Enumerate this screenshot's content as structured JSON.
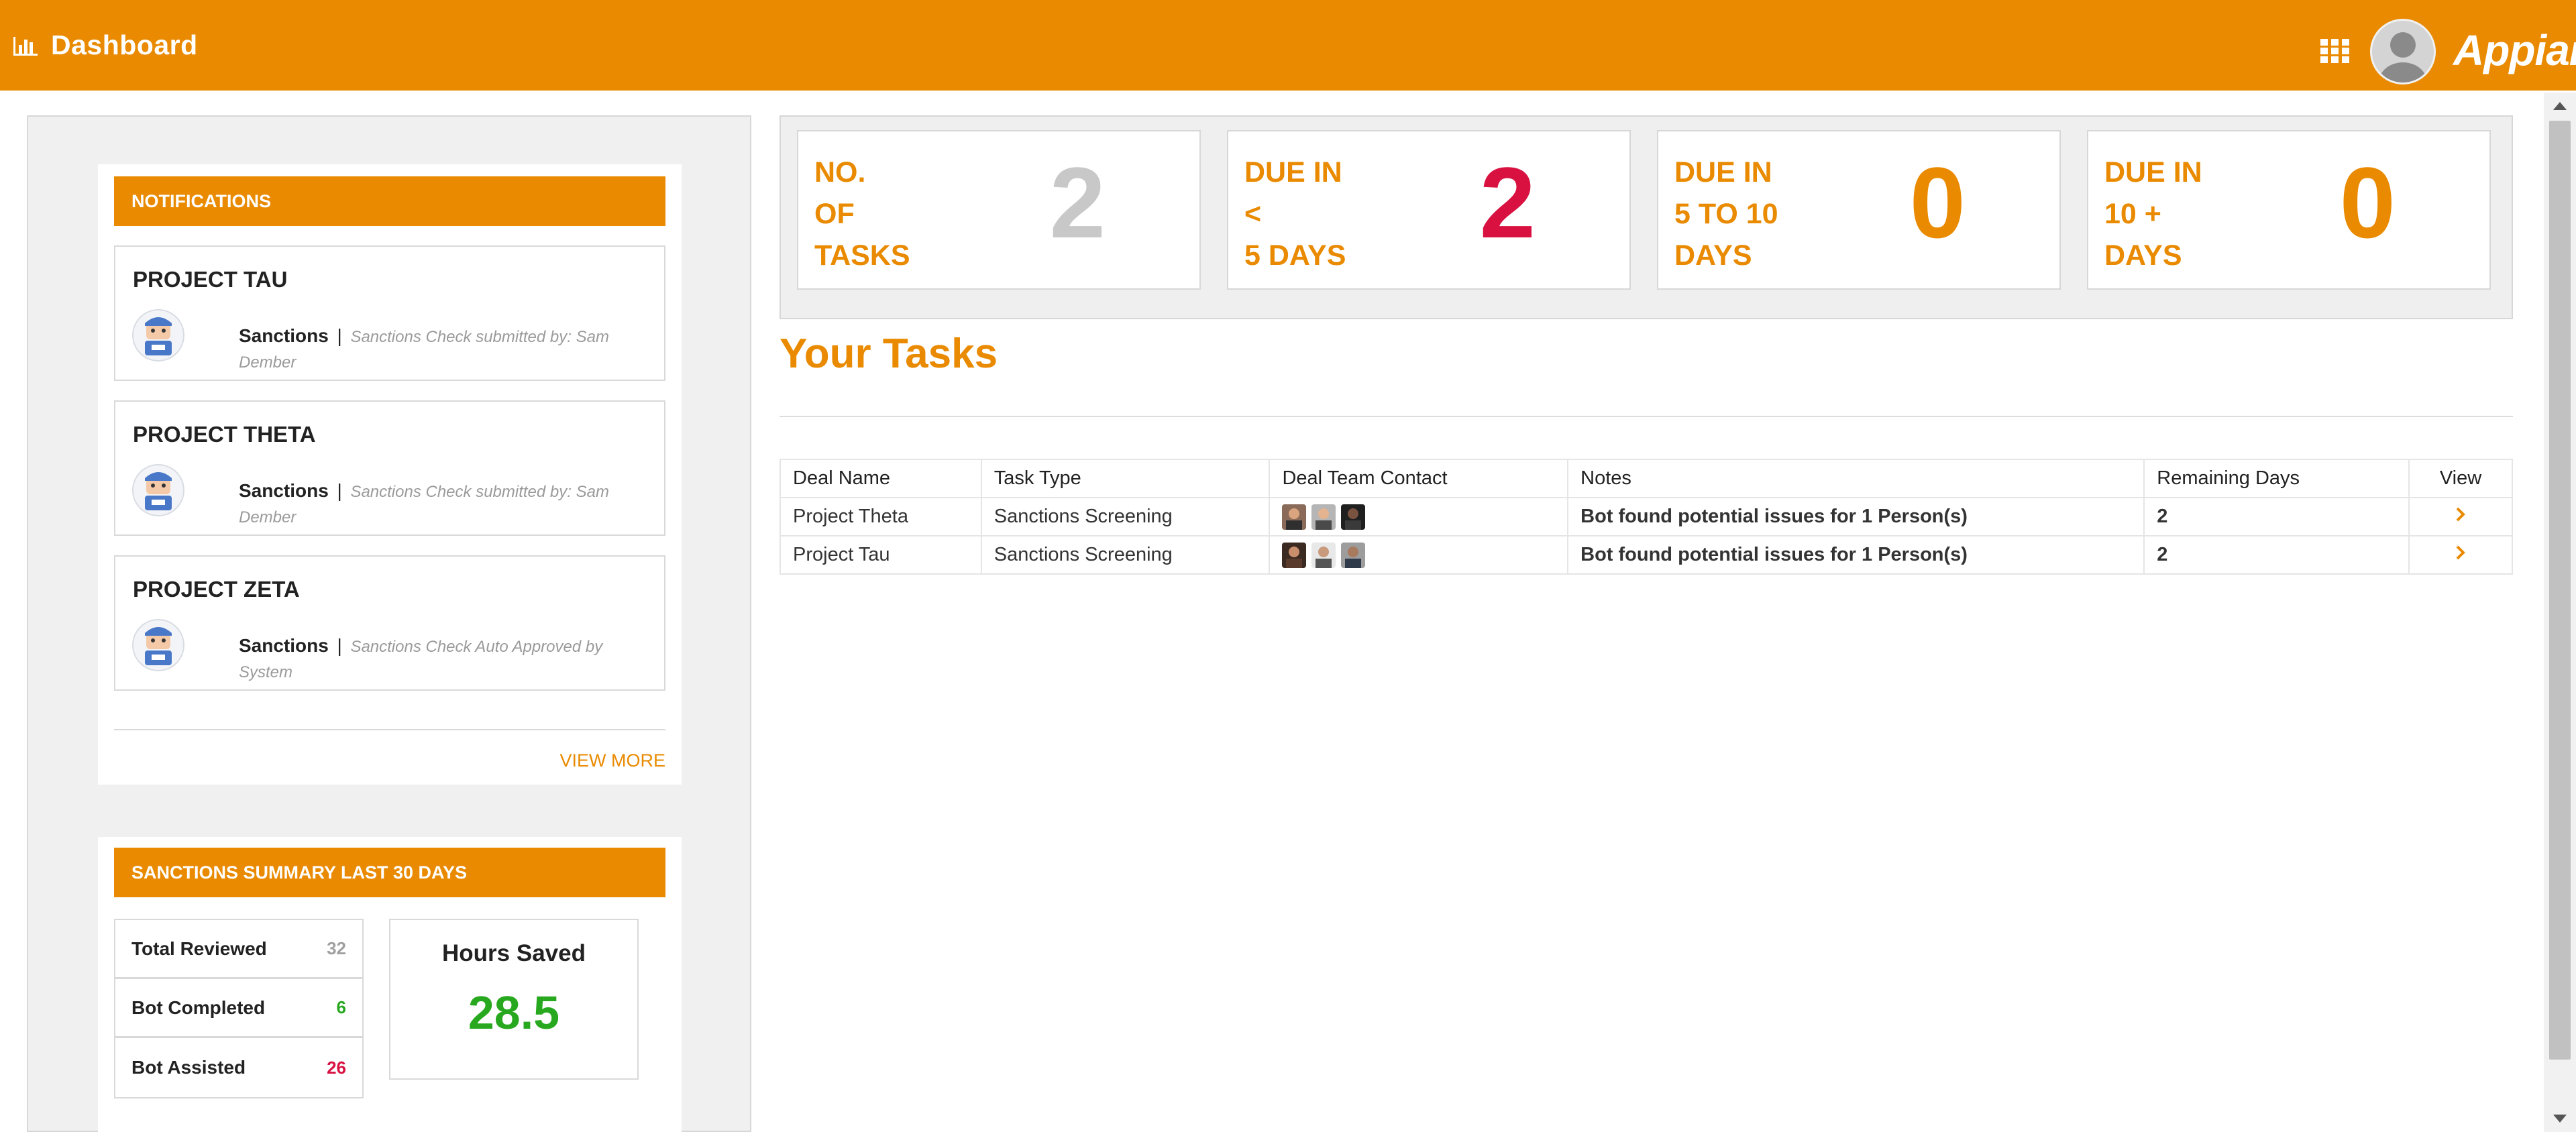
{
  "header": {
    "title": "Dashboard",
    "brand": "Appian",
    "accent_color": "#e98a00",
    "icons": [
      "bar-chart-icon",
      "app-grid-icon",
      "user-avatar-icon"
    ]
  },
  "notifications": {
    "title": "NOTIFICATIONS",
    "items": [
      {
        "project": "PROJECT TAU",
        "category": "Sanctions",
        "separator": "|",
        "text": "Sanctions Check submitted by: Sam Dember"
      },
      {
        "project": "PROJECT THETA",
        "category": "Sanctions",
        "separator": "|",
        "text": "Sanctions Check submitted by: Sam Dember"
      },
      {
        "project": "PROJECT ZETA",
        "category": "Sanctions",
        "separator": "|",
        "text": "Sanctions Check Auto Approved by System"
      }
    ],
    "view_more": "VIEW MORE"
  },
  "summary": {
    "title": "SANCTIONS SUMMARY LAST 30 DAYS",
    "rows": [
      {
        "label": "Total Reviewed",
        "value": "32",
        "color": "#a0a0a0"
      },
      {
        "label": "Bot Completed",
        "value": "6",
        "color": "#27a81e"
      },
      {
        "label": "Bot Assisted",
        "value": "26",
        "color": "#d81141"
      }
    ],
    "hours_label": "Hours Saved",
    "hours_value": "28.5"
  },
  "kpis": [
    {
      "label": "NO.\nOF\nTASKS",
      "value": "2",
      "color": "#c8c8c8"
    },
    {
      "label": "DUE IN\n<\n5 DAYS",
      "value": "2",
      "color": "#d81141"
    },
    {
      "label": "DUE IN\n5 TO 10\nDAYS",
      "value": "0",
      "color": "#e98a00"
    },
    {
      "label": "DUE IN\n10 +\nDAYS",
      "value": "0",
      "color": "#e98a00"
    }
  ],
  "tasks": {
    "title": "Your Tasks",
    "columns": [
      "Deal Name",
      "Task Type",
      "Deal Team Contact",
      "Notes",
      "Remaining Days",
      "View"
    ],
    "rows": [
      {
        "deal": "Project Theta",
        "type": "Sanctions Screening",
        "contacts": [
          "contact-1",
          "contact-2",
          "contact-3"
        ],
        "notes": "Bot found potential issues for 1 Person(s)",
        "days": "2"
      },
      {
        "deal": "Project Tau",
        "type": "Sanctions Screening",
        "contacts": [
          "contact-4",
          "contact-5",
          "contact-6"
        ],
        "notes": "Bot found potential issues for 1 Person(s)",
        "days": "2"
      }
    ]
  }
}
